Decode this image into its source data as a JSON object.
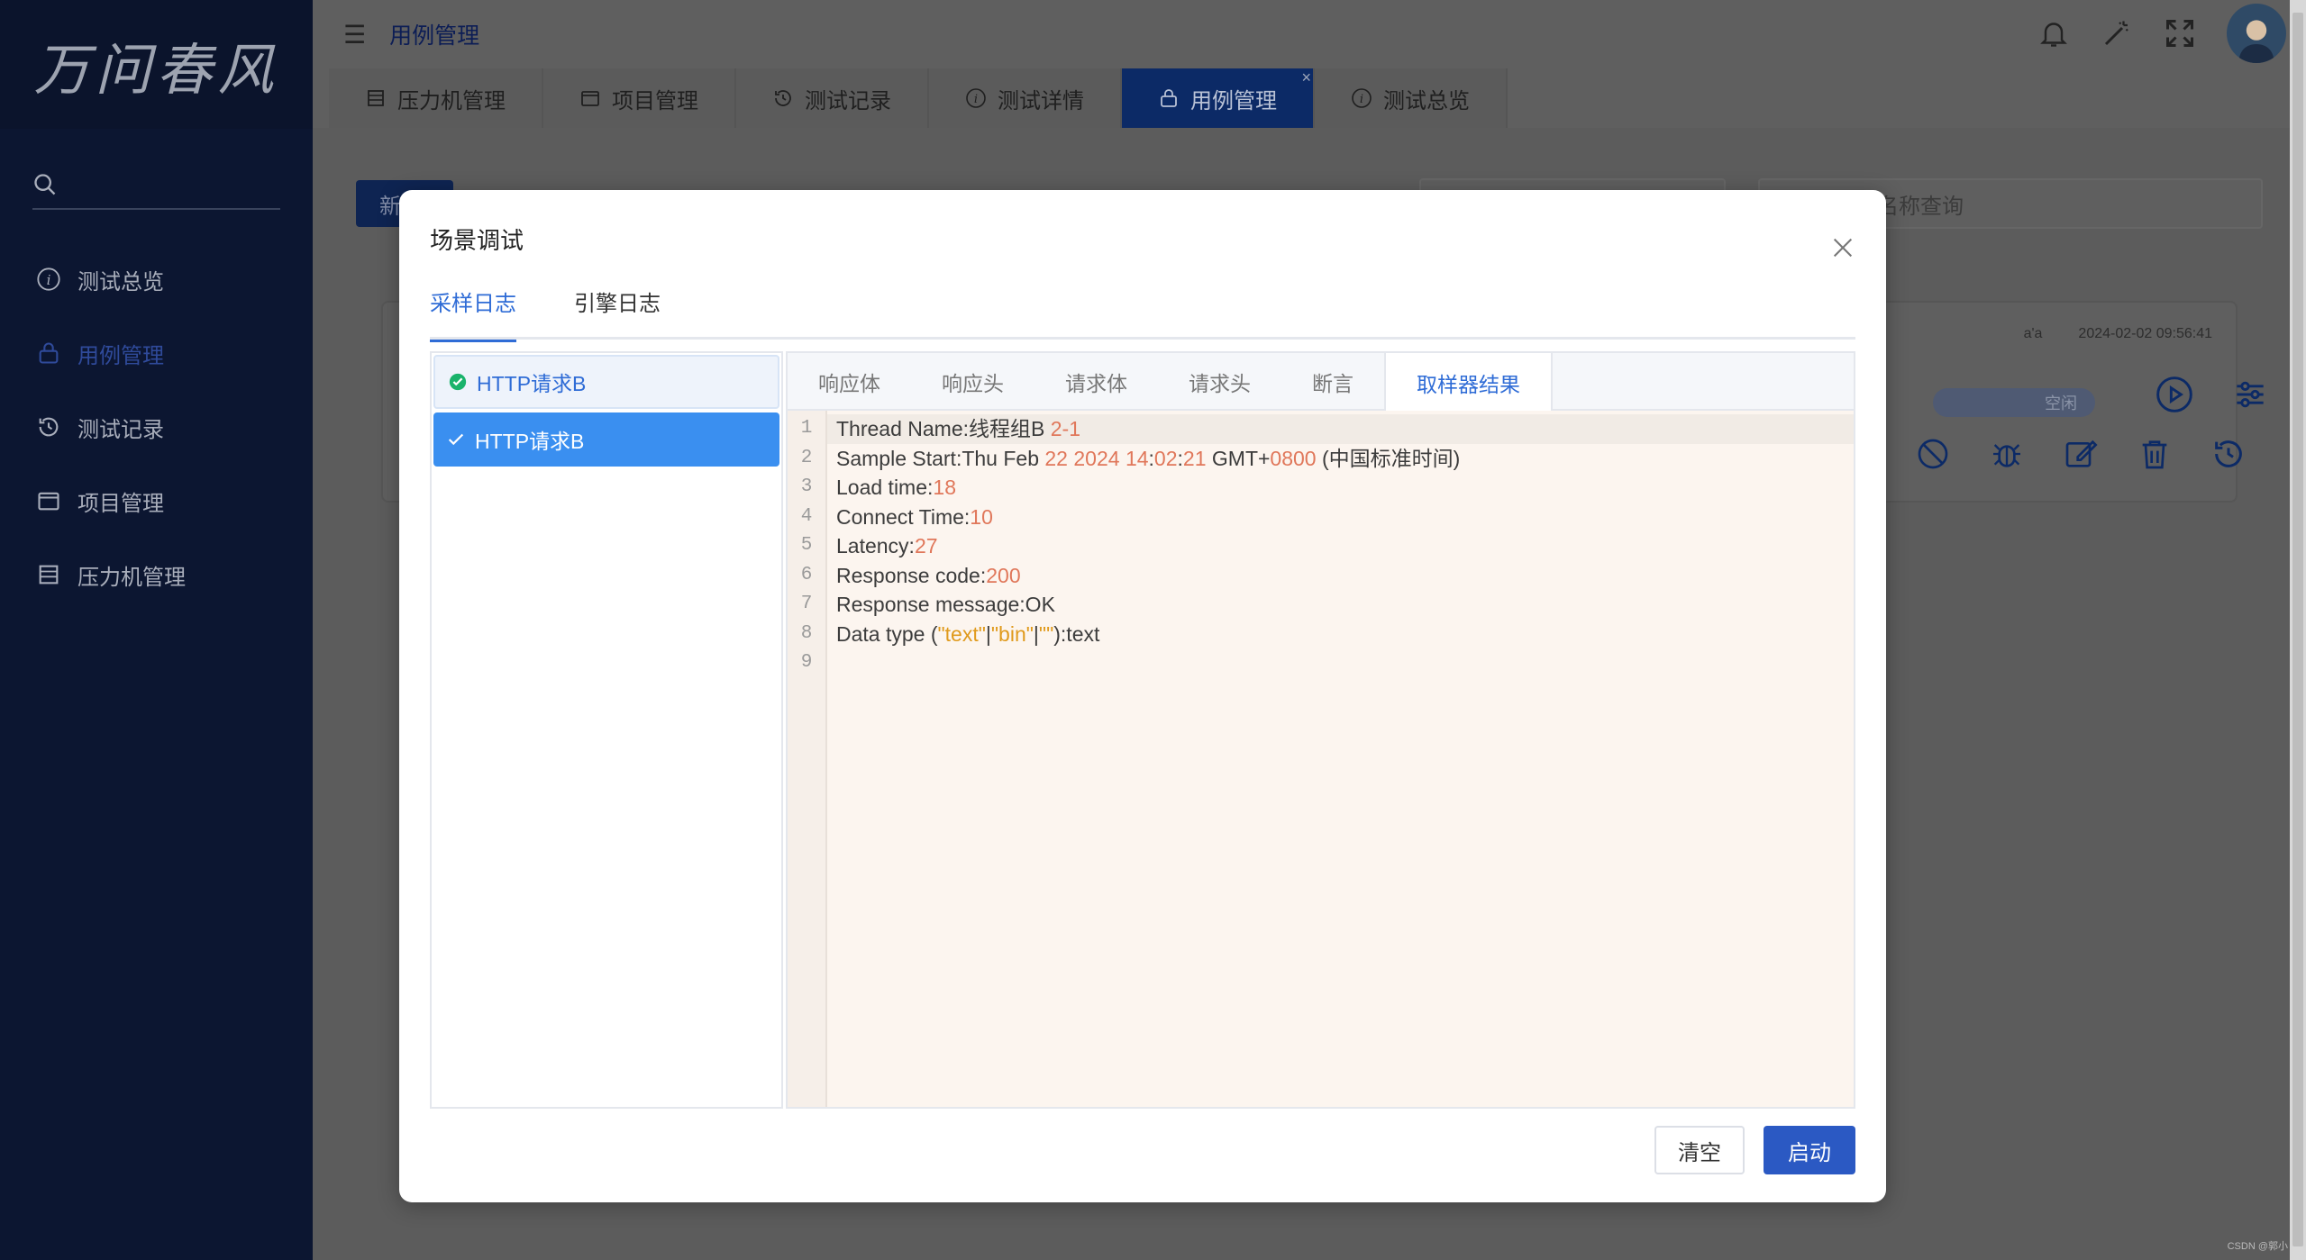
{
  "sidebar": {
    "logo_text": "万问春风",
    "items": [
      {
        "label": "测试总览",
        "icon": "info-icon"
      },
      {
        "label": "用例管理",
        "icon": "lock-icon",
        "active": true
      },
      {
        "label": "测试记录",
        "icon": "history-icon"
      },
      {
        "label": "项目管理",
        "icon": "window-icon"
      },
      {
        "label": "压力机管理",
        "icon": "server-icon"
      }
    ]
  },
  "header": {
    "breadcrumb": "用例管理",
    "tabs": [
      {
        "label": "压力机管理",
        "icon": "server-icon"
      },
      {
        "label": "项目管理",
        "icon": "window-icon"
      },
      {
        "label": "测试记录",
        "icon": "history-icon"
      },
      {
        "label": "测试详情",
        "icon": "info-icon"
      },
      {
        "label": "用例管理",
        "icon": "lock-icon",
        "active": true
      },
      {
        "label": "测试总览",
        "icon": "info-icon"
      }
    ]
  },
  "background": {
    "new_button": "新",
    "search_placeholder": "名称查询",
    "card": {
      "author": "a'a",
      "timestamp": "2024-02-02 09:56:41",
      "status": "空闲"
    }
  },
  "modal": {
    "title": "场景调试",
    "tabs": [
      "采样日志",
      "引擎日志"
    ],
    "samples": [
      "HTTP请求B",
      "HTTP请求B"
    ],
    "result_tabs": [
      "响应体",
      "响应头",
      "请求体",
      "请求头",
      "断言",
      "取样器结果"
    ],
    "line_numbers": [
      "1",
      "2",
      "3",
      "4",
      "5",
      "6",
      "7",
      "8",
      "9"
    ],
    "code_lines": [
      "Thread Name:线程组B 2-1",
      "Sample Start:Thu Feb 22 2024 14:02:21 GMT+0800 (中国标准时间)",
      "Load time:18",
      "Connect Time:10",
      "Latency:27",
      "Response code:200",
      "Response message:OK",
      "Data type (\"text\"|\"bin\"|\"\"):text",
      ""
    ],
    "clear_button": "清空",
    "start_button": "启动"
  },
  "watermark": "CSDN @郭小",
  "colors": {
    "accent": "#2f6cd6",
    "primary_button": "#2b59c3",
    "sidebar_bg": "#0c1631",
    "selected_item": "#3a8ff0"
  }
}
